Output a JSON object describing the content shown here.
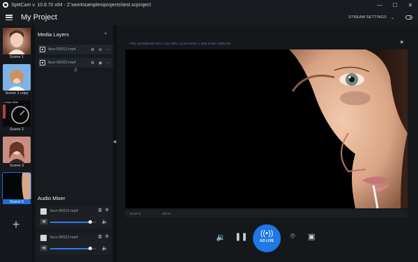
{
  "window": {
    "title": "SplitCam v. 10.8.70 x64 - Z:\\work\\samples\\projects\\test.scproject",
    "minimize": "—",
    "maximize": "☐",
    "close": "✕"
  },
  "header": {
    "project_title": "My Project",
    "stream_settings": "STREAM SETTINGS",
    "chevron": "⌄"
  },
  "scenes": [
    {
      "label": "Scene 1"
    },
    {
      "label": "Scene 1 copy"
    },
    {
      "label": "Scene 2",
      "overlay": "● 60fps Meter"
    },
    {
      "label": "Scene 3"
    },
    {
      "label": "Scene 5",
      "active": true
    }
  ],
  "add_scene": "+",
  "media_layers": {
    "title": "Media Layers",
    "add": "+",
    "items": [
      {
        "name": "face-00012.mp4"
      },
      {
        "name": "face-00022.mp4"
      }
    ]
  },
  "audio_mixer": {
    "title": "Audio Mixer",
    "items": [
      {
        "name": "face-00012.mp4",
        "volume": 0.87
      },
      {
        "name": "face-00022.mp4",
        "volume": 0.87
      }
    ]
  },
  "preview": {
    "stats": "FPS: 30.00/30.00     CPU: 4.2%     GPU: 12.6%     RAM: 1.2GB     RAW: 1280x720",
    "scene_name": "Scene 5",
    "zoom": "100 %"
  },
  "controls": {
    "go_live": "GO LIVE"
  },
  "colors": {
    "accent": "#1e78e6",
    "active_scene": "#1e6fe0"
  }
}
